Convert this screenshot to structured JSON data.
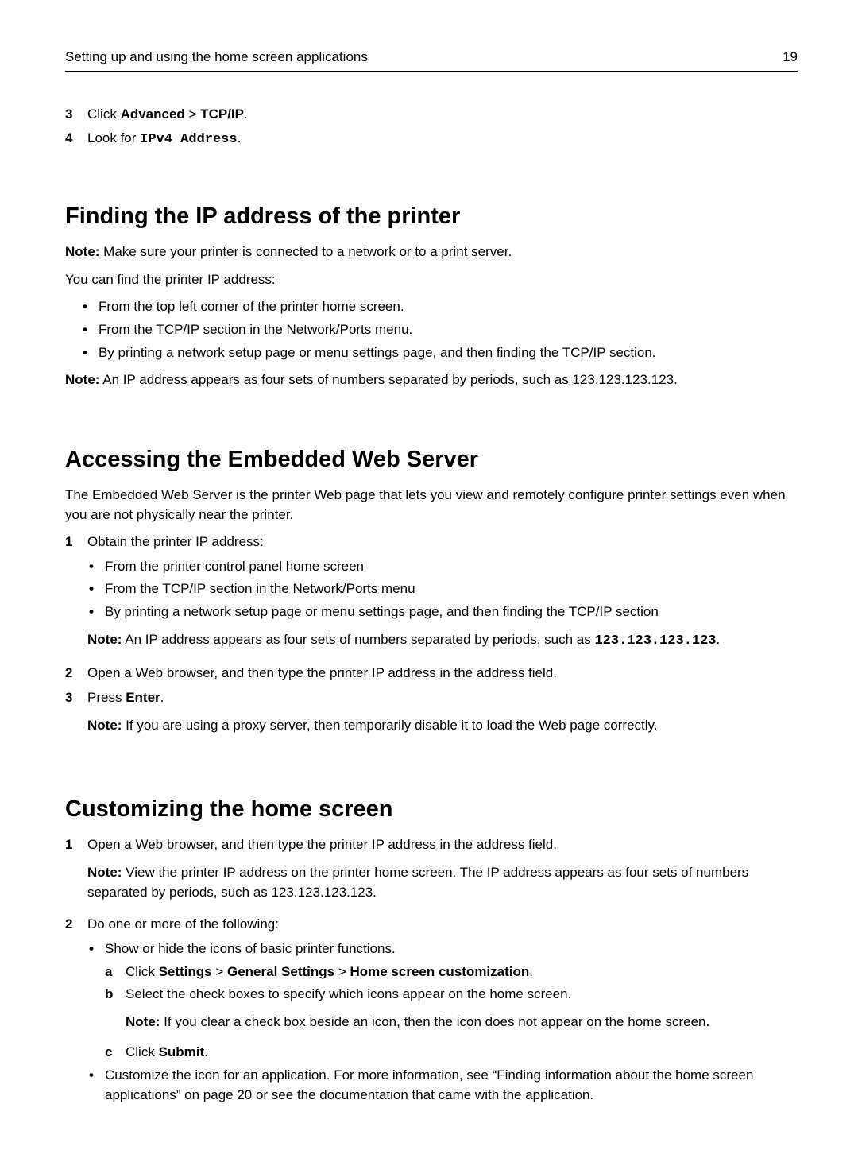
{
  "header": {
    "title": "Setting up and using the home screen applications",
    "page": "19"
  },
  "topsteps": {
    "s3_num": "3",
    "s3_pre": "Click ",
    "s3_b1": "Advanced",
    "s3_mid": " > ",
    "s3_b2": "TCP/IP",
    "s3_post": ".",
    "s4_num": "4",
    "s4_pre": "Look for ",
    "s4_mono": "IPv4 Address",
    "s4_post": "."
  },
  "sec1": {
    "heading": "Finding the IP address of the printer",
    "note1_b": "Note:",
    "note1_t": " Make sure your printer is connected to a network or to a print server.",
    "p1": "You can find the printer IP address:",
    "b1": "From the top left corner of the printer home screen.",
    "b2": "From the TCP/IP section in the Network/Ports menu.",
    "b3": "By printing a network setup page or menu settings page, and then finding the TCP/IP section.",
    "note2_b": "Note:",
    "note2_t": " An IP address appears as four sets of numbers separated by periods, such as 123.123.123.123."
  },
  "sec2": {
    "heading": "Accessing the Embedded Web Server",
    "p1": "The Embedded Web Server is the printer Web page that lets you view and remotely configure printer settings even when you are not physically near the printer.",
    "s1_num": "1",
    "s1_t": "Obtain the printer IP address:",
    "s1_b1": "From the printer control panel home screen",
    "s1_b2": "From the TCP/IP section in the Network/Ports menu",
    "s1_b3": "By printing a network setup page or menu settings page, and then finding the TCP/IP section",
    "s1_note_b": "Note:",
    "s1_note_t": " An IP address appears as four sets of numbers separated by periods, such as ",
    "s1_note_mono": "123.123.123.123",
    "s1_note_post": ".",
    "s2_num": "2",
    "s2_t": "Open a Web browser, and then type the printer IP address in the address field.",
    "s3_num": "3",
    "s3_pre": "Press ",
    "s3_b": "Enter",
    "s3_post": ".",
    "s3_note_b": "Note:",
    "s3_note_t": " If you are using a proxy server, then temporarily disable it to load the Web page correctly."
  },
  "sec3": {
    "heading": "Customizing the home screen",
    "s1_num": "1",
    "s1_t": "Open a Web browser, and then type the printer IP address in the address field.",
    "s1_note_b": "Note:",
    "s1_note_t": " View the printer IP address on the printer home screen. The IP address appears as four sets of numbers separated by periods, such as 123.123.123.123.",
    "s2_num": "2",
    "s2_t": "Do one or more of the following:",
    "s2_b1": "Show or hide the icons of basic printer functions.",
    "s2_a_num": "a",
    "s2_a_pre": "Click ",
    "s2_a_b1": "Settings",
    "s2_a_m1": " > ",
    "s2_a_b2": "General Settings",
    "s2_a_m2": " > ",
    "s2_a_b3": "Home screen customization",
    "s2_a_post": ".",
    "s2_bnum": "b",
    "s2_b_t": "Select the check boxes to specify which icons appear on the home screen.",
    "s2_b_note_b": "Note:",
    "s2_b_note_t": " If you clear a check box beside an icon, then the icon does not appear on the home screen.",
    "s2_c_num": "c",
    "s2_c_pre": "Click ",
    "s2_c_b": "Submit",
    "s2_c_post": ".",
    "s2_b2t": "Customize the icon for an application. For more information, see “Finding information about the home screen applications” on page 20 or see the documentation that came with the application."
  }
}
